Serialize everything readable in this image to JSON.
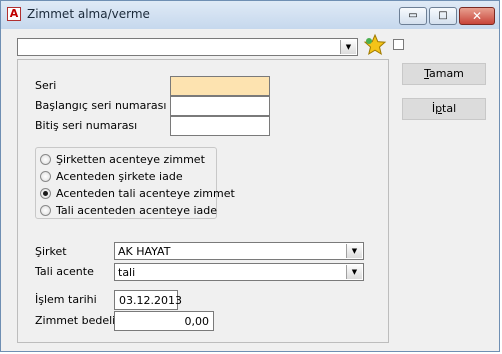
{
  "window": {
    "title": "Zimmet alma/verme",
    "app_icon_glyph": "A",
    "controls": {
      "minimize": "▭",
      "maximize": "□",
      "close": "✕"
    }
  },
  "top_combo": {
    "value": ""
  },
  "fields": {
    "seri_label": "Seri",
    "baslangic_label": "Başlangıç seri numarası",
    "bitis_label": "Bitiş seri numarası",
    "seri_value": "",
    "baslangic_value": "",
    "bitis_value": ""
  },
  "radio_options": [
    {
      "label": "Şirketten acenteye zimmet",
      "checked": false
    },
    {
      "label": "Acenteden şirkete iade",
      "checked": false
    },
    {
      "label": "Acenteden tali acenteye zimmet",
      "checked": true
    },
    {
      "label": "Tali acenteden acenteye iade",
      "checked": false
    }
  ],
  "sirket": {
    "label": "Şirket",
    "value": "AK HAYAT"
  },
  "tali_acente": {
    "label": "Tali acente",
    "value": "tali"
  },
  "islem_tarihi": {
    "label": "İşlem tarihi",
    "value": "03.12.2013"
  },
  "zimmet_bedeli": {
    "label": "Zimmet bedeli",
    "value": "0,00"
  },
  "buttons": {
    "ok_prefix": "",
    "ok_ul": "T",
    "ok_rest": "amam",
    "cancel_prefix": "İ",
    "cancel_ul": "p",
    "cancel_rest": "tal"
  },
  "colors": {
    "required_field": "#fde3b0",
    "title_gradient": "#c6d8ed"
  },
  "icons": [
    "app-icon",
    "star-icon",
    "dropdown-arrow-icon"
  ]
}
